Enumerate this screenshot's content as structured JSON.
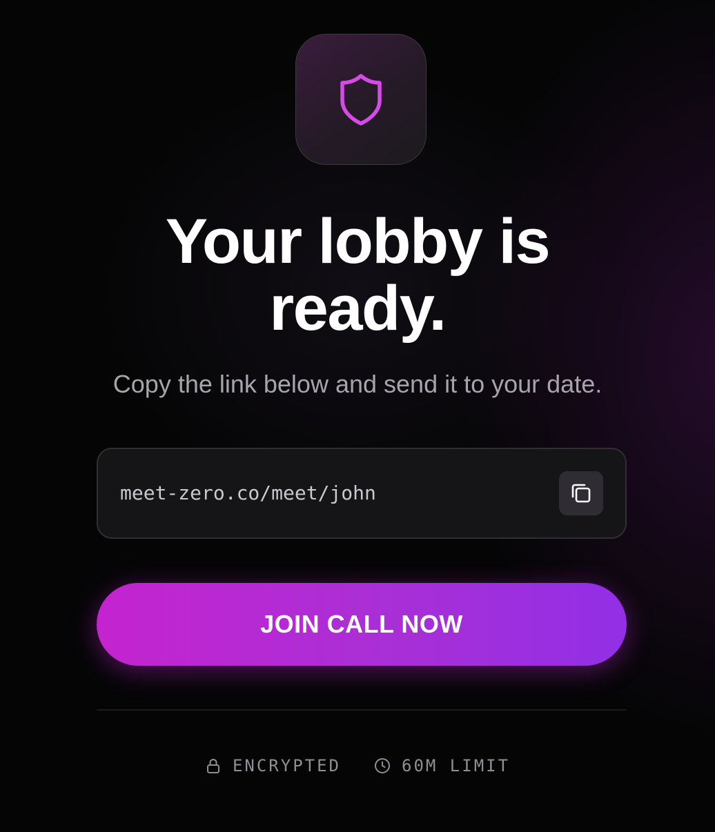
{
  "app_icon": {
    "name": "shield-icon",
    "color": "#d64ae6"
  },
  "headline": {
    "line1": "Your lobby is",
    "line2": "ready."
  },
  "subtitle": "Copy the link below and send it to your date.",
  "link_box": {
    "url": "meet-zero.co/meet/john",
    "copy_icon": "copy-icon"
  },
  "join_button": {
    "label": "JOIN CALL NOW",
    "gradient": [
      "#c424cf",
      "#922fe6"
    ]
  },
  "footer": {
    "items": [
      {
        "icon": "lock-icon",
        "label": "ENCRYPTED"
      },
      {
        "icon": "clock-icon",
        "label": "60M LIMIT"
      }
    ]
  },
  "colors": {
    "background": "#050506",
    "accent": "#d64ae6",
    "muted_text": "#8f8f96"
  }
}
